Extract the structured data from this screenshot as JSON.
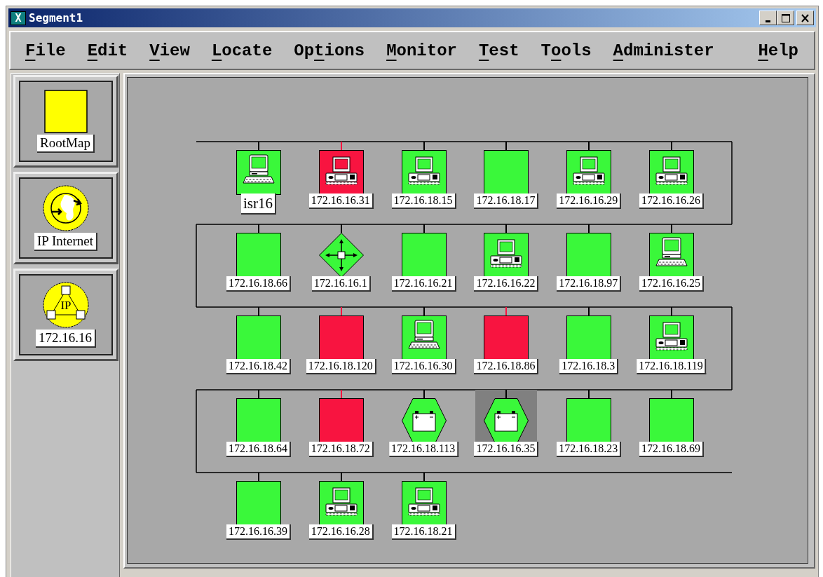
{
  "window": {
    "title": "Segment1",
    "icon_text": "X"
  },
  "menu": [
    {
      "key": "F",
      "post": "ile"
    },
    {
      "key": "E",
      "post": "dit"
    },
    {
      "key": "V",
      "post": "iew"
    },
    {
      "key": "L",
      "post": "ocate"
    },
    {
      "pre": "Op",
      "key": "t",
      "post": "ions"
    },
    {
      "key": "M",
      "post": "onitor"
    },
    {
      "key": "T",
      "post": "est"
    },
    {
      "pre": "T",
      "key": "o",
      "post": "ols"
    },
    {
      "key": "A",
      "post": "dminister"
    },
    {
      "key": "H",
      "post": "elp",
      "kind": "right"
    }
  ],
  "sidebar": {
    "items": [
      {
        "label": "RootMap",
        "kind": "folder"
      },
      {
        "label": "IP Internet",
        "kind": "internet"
      },
      {
        "label": "172.16.16",
        "kind": "network",
        "icon_text": "IP"
      }
    ]
  },
  "map": {
    "rows": [
      {
        "nodes": [
          {
            "label": "isr16",
            "kind": "workstation",
            "color": "#3af83a",
            "alarm": false,
            "selected": false,
            "large_label": true
          },
          {
            "label": "172.16.16.31",
            "kind": "pc",
            "color": "#f81440",
            "alarm": true,
            "selected": false,
            "large_label": false
          },
          {
            "label": "172.16.18.15",
            "kind": "pc",
            "color": "#3af83a",
            "alarm": false,
            "selected": false,
            "large_label": false
          },
          {
            "label": "172.16.18.17",
            "kind": "blank",
            "color": "#3af83a",
            "alarm": false,
            "selected": false,
            "large_label": false
          },
          {
            "label": "172.16.16.29",
            "kind": "pc",
            "color": "#3af83a",
            "alarm": false,
            "selected": false,
            "large_label": false
          },
          {
            "label": "172.16.16.26",
            "kind": "pc",
            "color": "#3af83a",
            "alarm": false,
            "selected": false,
            "large_label": false
          }
        ]
      },
      {
        "nodes": [
          {
            "label": "172.16.18.66",
            "kind": "blank",
            "color": "#3af83a",
            "alarm": false,
            "selected": false,
            "large_label": false
          },
          {
            "label": "172.16.16.1",
            "kind": "router",
            "color": "#3af83a",
            "alarm": false,
            "selected": false,
            "large_label": false
          },
          {
            "label": "172.16.16.21",
            "kind": "blank",
            "color": "#3af83a",
            "alarm": false,
            "selected": false,
            "large_label": false
          },
          {
            "label": "172.16.16.22",
            "kind": "pc",
            "color": "#3af83a",
            "alarm": false,
            "selected": false,
            "large_label": false
          },
          {
            "label": "172.16.18.97",
            "kind": "blank",
            "color": "#3af83a",
            "alarm": false,
            "selected": false,
            "large_label": false
          },
          {
            "label": "172.16.16.25",
            "kind": "workstation",
            "color": "#3af83a",
            "alarm": false,
            "selected": false,
            "large_label": false
          }
        ]
      },
      {
        "nodes": [
          {
            "label": "172.16.18.42",
            "kind": "blank",
            "color": "#3af83a",
            "alarm": false,
            "selected": false,
            "large_label": false
          },
          {
            "label": "172.16.18.120",
            "kind": "blank",
            "color": "#f81440",
            "alarm": true,
            "selected": false,
            "large_label": false
          },
          {
            "label": "172.16.16.30",
            "kind": "workstation",
            "color": "#3af83a",
            "alarm": false,
            "selected": false,
            "large_label": false
          },
          {
            "label": "172.16.18.86",
            "kind": "blank",
            "color": "#f81440",
            "alarm": true,
            "selected": false,
            "large_label": false
          },
          {
            "label": "172.16.18.3",
            "kind": "blank",
            "color": "#3af83a",
            "alarm": false,
            "selected": false,
            "large_label": false
          },
          {
            "label": "172.16.18.119",
            "kind": "pc",
            "color": "#3af83a",
            "alarm": false,
            "selected": false,
            "large_label": false
          }
        ]
      },
      {
        "nodes": [
          {
            "label": "172.16.18.64",
            "kind": "blank",
            "color": "#3af83a",
            "alarm": false,
            "selected": false,
            "large_label": false
          },
          {
            "label": "172.16.18.72",
            "kind": "blank",
            "color": "#f81440",
            "alarm": true,
            "selected": false,
            "large_label": false
          },
          {
            "label": "172.16.18.113",
            "kind": "battery",
            "color": "#3af83a",
            "alarm": false,
            "selected": false,
            "large_label": false
          },
          {
            "label": "172.16.16.35",
            "kind": "battery",
            "color": "#3af83a",
            "alarm": false,
            "selected": true,
            "large_label": false
          },
          {
            "label": "172.16.18.23",
            "kind": "blank",
            "color": "#3af83a",
            "alarm": false,
            "selected": false,
            "large_label": false
          },
          {
            "label": "172.16.18.69",
            "kind": "blank",
            "color": "#3af83a",
            "alarm": false,
            "selected": false,
            "large_label": false
          }
        ]
      },
      {
        "nodes": [
          {
            "label": "172.16.16.39",
            "kind": "blank",
            "color": "#3af83a",
            "alarm": false,
            "selected": false,
            "large_label": false
          },
          {
            "label": "172.16.16.28",
            "kind": "pc",
            "color": "#3af83a",
            "alarm": false,
            "selected": false,
            "large_label": false
          },
          {
            "label": "172.16.18.21",
            "kind": "pc",
            "color": "#3af83a",
            "alarm": false,
            "selected": false,
            "large_label": false
          }
        ]
      }
    ]
  }
}
